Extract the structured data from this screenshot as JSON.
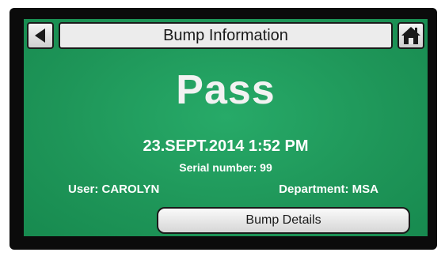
{
  "header": {
    "title": "Bump Information",
    "back_icon": "back-arrow-icon",
    "home_icon": "home-icon"
  },
  "result": {
    "status": "Pass"
  },
  "info": {
    "datetime": "23.SEPT.2014 1:52 PM",
    "serial": "Serial number: 99",
    "user": "User: CAROLYN",
    "department": "Department: MSA"
  },
  "actions": {
    "details_label": "Bump Details"
  },
  "colors": {
    "screen_background": "#1f9a5c",
    "button_face": "#ececec",
    "text": "#ffffff"
  }
}
